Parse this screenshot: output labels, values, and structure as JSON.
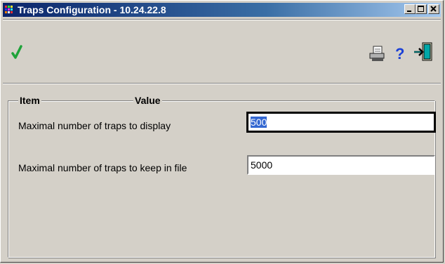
{
  "window": {
    "title": "Traps Configuration - 10.24.22.8",
    "controls": {
      "minimize": "minimize-icon",
      "maximize": "maximize-icon",
      "close": "close-icon"
    }
  },
  "toolbar": {
    "apply": {
      "icon": "checkmark-icon",
      "color": "#1fa33a"
    },
    "print": {
      "icon": "printer-icon"
    },
    "help": {
      "icon": "question-icon",
      "color": "#1a3fd6"
    },
    "exit": {
      "icon": "exit-door-icon",
      "color": "#00a8a8"
    }
  },
  "group": {
    "col_item": "Item",
    "col_value": "Value"
  },
  "settings": [
    {
      "label": "Maximal number of traps to display",
      "value": "500",
      "focused": true
    },
    {
      "label": "Maximal number of traps to keep in file",
      "value": "5000",
      "focused": false
    }
  ]
}
